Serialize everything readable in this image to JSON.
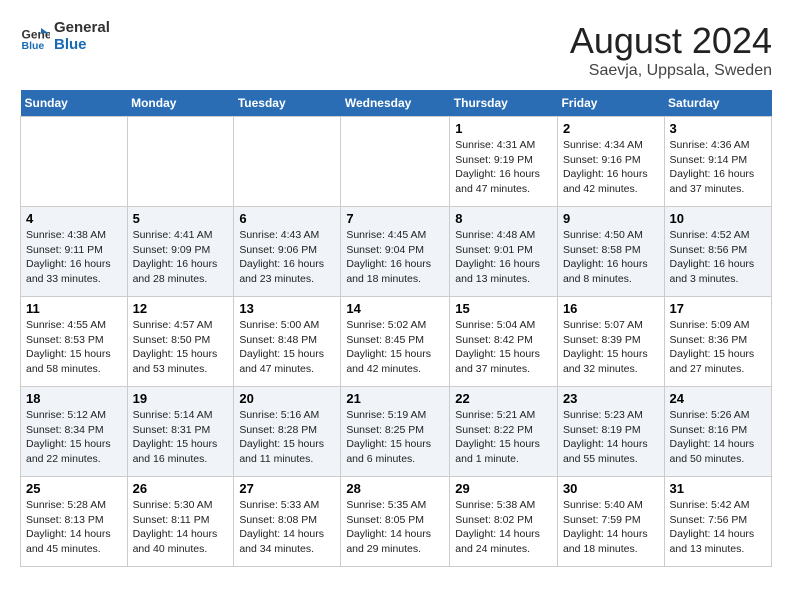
{
  "logo": {
    "line1": "General",
    "line2": "Blue"
  },
  "title": "August 2024",
  "subtitle": "Saevja, Uppsala, Sweden",
  "days_header": [
    "Sunday",
    "Monday",
    "Tuesday",
    "Wednesday",
    "Thursday",
    "Friday",
    "Saturday"
  ],
  "weeks": [
    [
      {
        "day": "",
        "info": ""
      },
      {
        "day": "",
        "info": ""
      },
      {
        "day": "",
        "info": ""
      },
      {
        "day": "",
        "info": ""
      },
      {
        "day": "1",
        "info": "Sunrise: 4:31 AM\nSunset: 9:19 PM\nDaylight: 16 hours\nand 47 minutes."
      },
      {
        "day": "2",
        "info": "Sunrise: 4:34 AM\nSunset: 9:16 PM\nDaylight: 16 hours\nand 42 minutes."
      },
      {
        "day": "3",
        "info": "Sunrise: 4:36 AM\nSunset: 9:14 PM\nDaylight: 16 hours\nand 37 minutes."
      }
    ],
    [
      {
        "day": "4",
        "info": "Sunrise: 4:38 AM\nSunset: 9:11 PM\nDaylight: 16 hours\nand 33 minutes."
      },
      {
        "day": "5",
        "info": "Sunrise: 4:41 AM\nSunset: 9:09 PM\nDaylight: 16 hours\nand 28 minutes."
      },
      {
        "day": "6",
        "info": "Sunrise: 4:43 AM\nSunset: 9:06 PM\nDaylight: 16 hours\nand 23 minutes."
      },
      {
        "day": "7",
        "info": "Sunrise: 4:45 AM\nSunset: 9:04 PM\nDaylight: 16 hours\nand 18 minutes."
      },
      {
        "day": "8",
        "info": "Sunrise: 4:48 AM\nSunset: 9:01 PM\nDaylight: 16 hours\nand 13 minutes."
      },
      {
        "day": "9",
        "info": "Sunrise: 4:50 AM\nSunset: 8:58 PM\nDaylight: 16 hours\nand 8 minutes."
      },
      {
        "day": "10",
        "info": "Sunrise: 4:52 AM\nSunset: 8:56 PM\nDaylight: 16 hours\nand 3 minutes."
      }
    ],
    [
      {
        "day": "11",
        "info": "Sunrise: 4:55 AM\nSunset: 8:53 PM\nDaylight: 15 hours\nand 58 minutes."
      },
      {
        "day": "12",
        "info": "Sunrise: 4:57 AM\nSunset: 8:50 PM\nDaylight: 15 hours\nand 53 minutes."
      },
      {
        "day": "13",
        "info": "Sunrise: 5:00 AM\nSunset: 8:48 PM\nDaylight: 15 hours\nand 47 minutes."
      },
      {
        "day": "14",
        "info": "Sunrise: 5:02 AM\nSunset: 8:45 PM\nDaylight: 15 hours\nand 42 minutes."
      },
      {
        "day": "15",
        "info": "Sunrise: 5:04 AM\nSunset: 8:42 PM\nDaylight: 15 hours\nand 37 minutes."
      },
      {
        "day": "16",
        "info": "Sunrise: 5:07 AM\nSunset: 8:39 PM\nDaylight: 15 hours\nand 32 minutes."
      },
      {
        "day": "17",
        "info": "Sunrise: 5:09 AM\nSunset: 8:36 PM\nDaylight: 15 hours\nand 27 minutes."
      }
    ],
    [
      {
        "day": "18",
        "info": "Sunrise: 5:12 AM\nSunset: 8:34 PM\nDaylight: 15 hours\nand 22 minutes."
      },
      {
        "day": "19",
        "info": "Sunrise: 5:14 AM\nSunset: 8:31 PM\nDaylight: 15 hours\nand 16 minutes."
      },
      {
        "day": "20",
        "info": "Sunrise: 5:16 AM\nSunset: 8:28 PM\nDaylight: 15 hours\nand 11 minutes."
      },
      {
        "day": "21",
        "info": "Sunrise: 5:19 AM\nSunset: 8:25 PM\nDaylight: 15 hours\nand 6 minutes."
      },
      {
        "day": "22",
        "info": "Sunrise: 5:21 AM\nSunset: 8:22 PM\nDaylight: 15 hours\nand 1 minute."
      },
      {
        "day": "23",
        "info": "Sunrise: 5:23 AM\nSunset: 8:19 PM\nDaylight: 14 hours\nand 55 minutes."
      },
      {
        "day": "24",
        "info": "Sunrise: 5:26 AM\nSunset: 8:16 PM\nDaylight: 14 hours\nand 50 minutes."
      }
    ],
    [
      {
        "day": "25",
        "info": "Sunrise: 5:28 AM\nSunset: 8:13 PM\nDaylight: 14 hours\nand 45 minutes."
      },
      {
        "day": "26",
        "info": "Sunrise: 5:30 AM\nSunset: 8:11 PM\nDaylight: 14 hours\nand 40 minutes."
      },
      {
        "day": "27",
        "info": "Sunrise: 5:33 AM\nSunset: 8:08 PM\nDaylight: 14 hours\nand 34 minutes."
      },
      {
        "day": "28",
        "info": "Sunrise: 5:35 AM\nSunset: 8:05 PM\nDaylight: 14 hours\nand 29 minutes."
      },
      {
        "day": "29",
        "info": "Sunrise: 5:38 AM\nSunset: 8:02 PM\nDaylight: 14 hours\nand 24 minutes."
      },
      {
        "day": "30",
        "info": "Sunrise: 5:40 AM\nSunset: 7:59 PM\nDaylight: 14 hours\nand 18 minutes."
      },
      {
        "day": "31",
        "info": "Sunrise: 5:42 AM\nSunset: 7:56 PM\nDaylight: 14 hours\nand 13 minutes."
      }
    ]
  ]
}
